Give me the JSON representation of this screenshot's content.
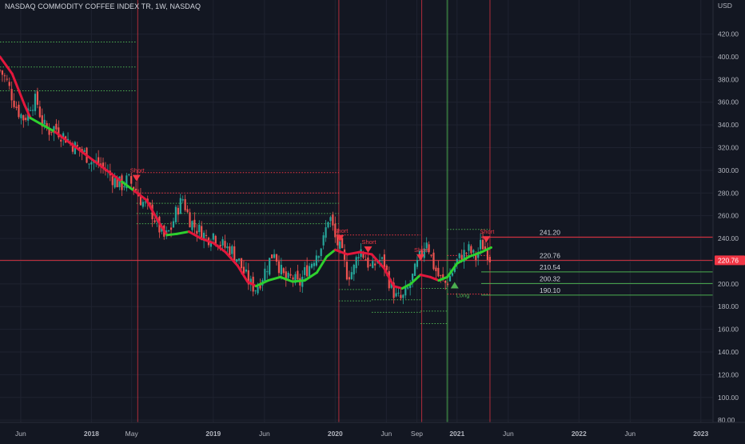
{
  "title": "NASDAQ COMMODITY COFFEE INDEX TR, 1W, NASDAQ",
  "currency": "USD",
  "chart_data": {
    "type": "candlestick",
    "xlim": [
      2017.25,
      2023.1
    ],
    "ylim": [
      78,
      450
    ],
    "y_ticks": [
      80,
      100,
      120,
      140,
      160,
      180,
      200,
      220,
      240,
      260,
      280,
      300,
      320,
      340,
      360,
      380,
      400,
      420
    ],
    "y_tick_labels": [
      "80.00",
      "100.00",
      "120.00",
      "140.00",
      "160.00",
      "180.00",
      "200.00",
      "220.00",
      "240.00",
      "260.00",
      "280.00",
      "300.00",
      "320.00",
      "340.00",
      "360.00",
      "380.00",
      "400.00",
      "420.00"
    ],
    "x_ticks": [
      {
        "label": "Jun",
        "t": 2017.42
      },
      {
        "label": "2018",
        "t": 2018.0
      },
      {
        "label": "May",
        "t": 2018.33
      },
      {
        "label": "2019",
        "t": 2019.0
      },
      {
        "label": "Jun",
        "t": 2019.42
      },
      {
        "label": "2020",
        "t": 2020.0
      },
      {
        "label": "Jun",
        "t": 2020.42
      },
      {
        "label": "Sep",
        "t": 2020.67
      },
      {
        "label": "2021",
        "t": 2021.0
      },
      {
        "label": "Jun",
        "t": 2021.42
      },
      {
        "label": "2022",
        "t": 2022.0
      },
      {
        "label": "Jun",
        "t": 2022.42
      },
      {
        "label": "2023",
        "t": 2023.0
      }
    ],
    "close_path": [
      [
        2017.25,
        388
      ],
      [
        2017.3,
        380
      ],
      [
        2017.35,
        365
      ],
      [
        2017.4,
        352
      ],
      [
        2017.45,
        345
      ],
      [
        2017.5,
        358
      ],
      [
        2017.55,
        362
      ],
      [
        2017.6,
        340
      ],
      [
        2017.65,
        335
      ],
      [
        2017.7,
        338
      ],
      [
        2017.75,
        332
      ],
      [
        2017.8,
        328
      ],
      [
        2017.85,
        322
      ],
      [
        2017.9,
        318
      ],
      [
        2017.95,
        314
      ],
      [
        2018.0,
        308
      ],
      [
        2018.05,
        306
      ],
      [
        2018.1,
        302
      ],
      [
        2018.15,
        296
      ],
      [
        2018.2,
        290
      ],
      [
        2018.25,
        287
      ],
      [
        2018.3,
        292
      ],
      [
        2018.36,
        284
      ],
      [
        2018.4,
        275
      ],
      [
        2018.45,
        268
      ],
      [
        2018.5,
        262
      ],
      [
        2018.55,
        250
      ],
      [
        2018.6,
        240
      ],
      [
        2018.65,
        248
      ],
      [
        2018.7,
        265
      ],
      [
        2018.75,
        275
      ],
      [
        2018.8,
        258
      ],
      [
        2018.85,
        250
      ],
      [
        2018.9,
        246
      ],
      [
        2018.95,
        240
      ],
      [
        2019.0,
        244
      ],
      [
        2019.05,
        236
      ],
      [
        2019.1,
        232
      ],
      [
        2019.15,
        230
      ],
      [
        2019.2,
        222
      ],
      [
        2019.25,
        210
      ],
      [
        2019.3,
        200
      ],
      [
        2019.35,
        196
      ],
      [
        2019.4,
        206
      ],
      [
        2019.45,
        218
      ],
      [
        2019.5,
        230
      ],
      [
        2019.55,
        212
      ],
      [
        2019.6,
        202
      ],
      [
        2019.65,
        206
      ],
      [
        2019.7,
        198
      ],
      [
        2019.75,
        210
      ],
      [
        2019.8,
        218
      ],
      [
        2019.85,
        228
      ],
      [
        2019.9,
        236
      ],
      [
        2019.95,
        262
      ],
      [
        2020.0,
        240
      ],
      [
        2020.05,
        228
      ],
      [
        2020.1,
        208
      ],
      [
        2020.15,
        212
      ],
      [
        2020.2,
        232
      ],
      [
        2020.25,
        222
      ],
      [
        2020.3,
        212
      ],
      [
        2020.35,
        222
      ],
      [
        2020.4,
        218
      ],
      [
        2020.45,
        200
      ],
      [
        2020.5,
        188
      ],
      [
        2020.55,
        186
      ],
      [
        2020.6,
        196
      ],
      [
        2020.65,
        210
      ],
      [
        2020.7,
        225
      ],
      [
        2020.75,
        240
      ],
      [
        2020.8,
        218
      ],
      [
        2020.85,
        206
      ],
      [
        2020.9,
        200
      ],
      [
        2020.95,
        208
      ],
      [
        2021.0,
        220
      ],
      [
        2021.05,
        226
      ],
      [
        2021.1,
        230
      ],
      [
        2021.15,
        222
      ],
      [
        2021.2,
        236
      ],
      [
        2021.25,
        228
      ],
      [
        2021.28,
        220.76
      ]
    ],
    "signal_line": [
      [
        2017.25,
        400,
        "r"
      ],
      [
        2017.35,
        385,
        "r"
      ],
      [
        2017.45,
        358,
        "r"
      ],
      [
        2017.5,
        346,
        "g"
      ],
      [
        2017.6,
        340,
        "g"
      ],
      [
        2017.7,
        334,
        "r"
      ],
      [
        2017.9,
        318,
        "r"
      ],
      [
        2018.1,
        302,
        "r"
      ],
      [
        2018.25,
        290,
        "g"
      ],
      [
        2018.35,
        282,
        "r"
      ],
      [
        2018.45,
        274,
        "r"
      ],
      [
        2018.55,
        255,
        "r"
      ],
      [
        2018.62,
        243,
        "g"
      ],
      [
        2018.7,
        244,
        "g"
      ],
      [
        2018.8,
        246,
        "r"
      ],
      [
        2018.9,
        240,
        "r"
      ],
      [
        2019.0,
        236,
        "r"
      ],
      [
        2019.1,
        228,
        "r"
      ],
      [
        2019.2,
        216,
        "r"
      ],
      [
        2019.28,
        202,
        "r"
      ],
      [
        2019.35,
        198,
        "g"
      ],
      [
        2019.45,
        203,
        "g"
      ],
      [
        2019.55,
        206,
        "g"
      ],
      [
        2019.65,
        202,
        "g"
      ],
      [
        2019.75,
        203,
        "g"
      ],
      [
        2019.85,
        210,
        "g"
      ],
      [
        2019.93,
        224,
        "g"
      ],
      [
        2020.0,
        230,
        "r"
      ],
      [
        2020.1,
        226,
        "r"
      ],
      [
        2020.2,
        228,
        "r"
      ],
      [
        2020.3,
        226,
        "r"
      ],
      [
        2020.4,
        214,
        "r"
      ],
      [
        2020.48,
        198,
        "r"
      ],
      [
        2020.55,
        196,
        "g"
      ],
      [
        2020.62,
        200,
        "g"
      ],
      [
        2020.7,
        208,
        "r"
      ],
      [
        2020.78,
        206,
        "r"
      ],
      [
        2020.85,
        203,
        "g"
      ],
      [
        2020.92,
        206,
        "g"
      ],
      [
        2021.0,
        218,
        "g"
      ],
      [
        2021.1,
        224,
        "g"
      ],
      [
        2021.2,
        228,
        "g"
      ],
      [
        2021.28,
        232,
        "g"
      ]
    ],
    "horizontal_levels": [
      {
        "label": "241.20",
        "value": 241.2,
        "color": "#f23645"
      },
      {
        "label": "220.76",
        "value": 220.76,
        "color": "#f23645"
      },
      {
        "label": "210.54",
        "value": 210.54,
        "color": "#4caf50"
      },
      {
        "label": "200.32",
        "value": 200.32,
        "color": "#4caf50"
      },
      {
        "label": "190.10",
        "value": 190.1,
        "color": "#4caf50"
      }
    ],
    "current_price_label": "220.76",
    "vertical_markers": [
      {
        "t": 2018.38,
        "color": "#f23645"
      },
      {
        "t": 2020.03,
        "color": "#f23645"
      },
      {
        "t": 2020.71,
        "color": "#f23645"
      },
      {
        "t": 2020.92,
        "color": "#4caf50"
      },
      {
        "t": 2021.27,
        "color": "#f23645"
      }
    ],
    "signals": [
      {
        "label": "Short",
        "t": 2018.37,
        "value": 296,
        "direction": "down",
        "color": "#f23645"
      },
      {
        "label": "Short",
        "t": 2020.04,
        "value": 243,
        "direction": "down",
        "color": "#f23645"
      },
      {
        "label": "Short",
        "t": 2020.27,
        "value": 233,
        "direction": "down",
        "color": "#f23645"
      },
      {
        "label": "Short",
        "t": 2020.7,
        "value": 226,
        "direction": "down",
        "color": "#f23645"
      },
      {
        "label": "Long",
        "t": 2020.98,
        "value": 196,
        "direction": "up",
        "color": "#4caf50"
      },
      {
        "label": "Short",
        "t": 2021.24,
        "value": 242,
        "direction": "down",
        "color": "#f23645"
      }
    ],
    "stop_levels": [
      {
        "t0": 2017.25,
        "t1": 2018.37,
        "value": 413,
        "color": "#4caf50"
      },
      {
        "t0": 2017.25,
        "t1": 2018.37,
        "value": 391,
        "color": "#4caf50"
      },
      {
        "t0": 2017.25,
        "t1": 2018.37,
        "value": 370,
        "color": "#4caf50"
      },
      {
        "t0": 2018.37,
        "t1": 2020.03,
        "value": 298,
        "color": "#f23645"
      },
      {
        "t0": 2018.37,
        "t1": 2020.03,
        "value": 280,
        "color": "#f23645"
      },
      {
        "t0": 2018.37,
        "t1": 2020.03,
        "value": 271,
        "color": "#4caf50"
      },
      {
        "t0": 2018.37,
        "t1": 2020.03,
        "value": 262,
        "color": "#4caf50"
      },
      {
        "t0": 2018.37,
        "t1": 2020.03,
        "value": 253,
        "color": "#4caf50"
      },
      {
        "t0": 2020.03,
        "t1": 2020.7,
        "value": 243,
        "color": "#f23645"
      },
      {
        "t0": 2020.03,
        "t1": 2020.3,
        "value": 195,
        "color": "#4caf50"
      },
      {
        "t0": 2020.03,
        "t1": 2020.3,
        "value": 185,
        "color": "#4caf50"
      },
      {
        "t0": 2020.3,
        "t1": 2020.7,
        "value": 186,
        "color": "#4caf50"
      },
      {
        "t0": 2020.3,
        "t1": 2020.7,
        "value": 175,
        "color": "#4caf50"
      },
      {
        "t0": 2020.7,
        "t1": 2020.92,
        "value": 196,
        "color": "#4caf50"
      },
      {
        "t0": 2020.7,
        "t1": 2020.92,
        "value": 176,
        "color": "#4caf50"
      },
      {
        "t0": 2020.7,
        "t1": 2020.92,
        "value": 165,
        "color": "#4caf50"
      },
      {
        "t0": 2020.92,
        "t1": 2021.27,
        "value": 248,
        "color": "#4caf50"
      },
      {
        "t0": 2020.92,
        "t1": 2021.27,
        "value": 225,
        "color": "#f23645"
      },
      {
        "t0": 2020.92,
        "t1": 2021.27,
        "value": 191,
        "color": "#f23645"
      }
    ],
    "colors": {
      "background": "#131722",
      "grid": "#1f2330",
      "axis_text": "#b2b5be",
      "up": "#26a69a",
      "down": "#ef5350",
      "bear_line": "#e3173c",
      "bull_line": "#2ed02e"
    },
    "grid": true
  }
}
